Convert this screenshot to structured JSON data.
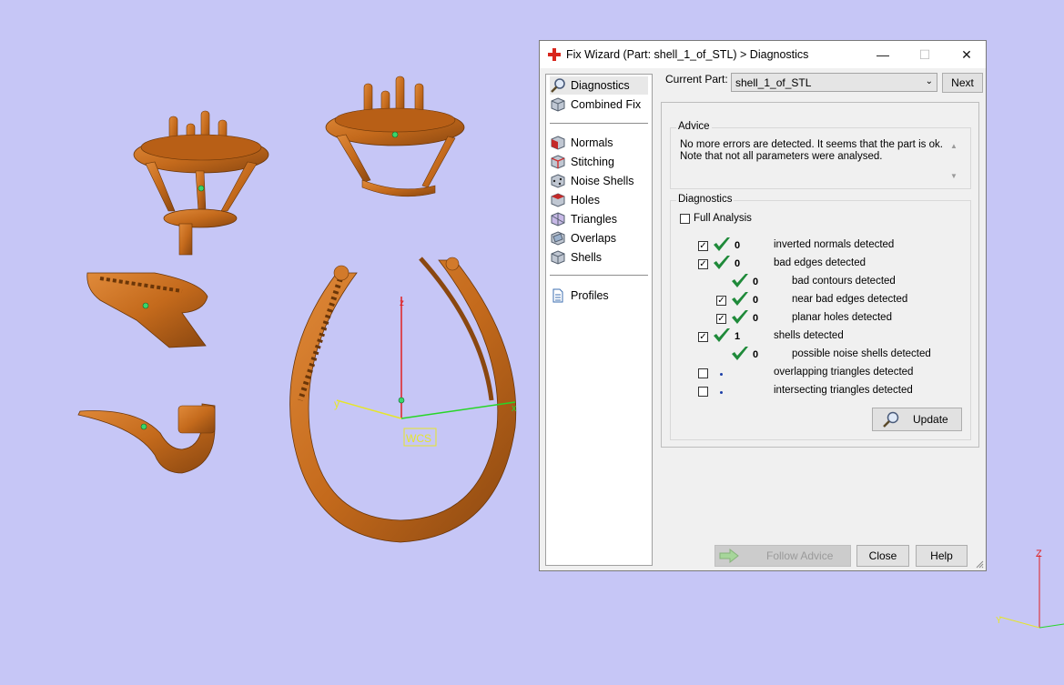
{
  "viewport": {
    "wcs_label": "WCS",
    "axis_z": "z",
    "axis_y": "y",
    "axis_x": "x",
    "corner_axis_z": "Z",
    "corner_axis_y": "Y",
    "model_color": "#c46a1c",
    "background": "#c6c6f6"
  },
  "dialog": {
    "title": "Fix Wizard (Part: shell_1_of_STL) > Diagnostics",
    "title_icon": "red-cross-icon",
    "nav": {
      "items_top": [
        {
          "label": "Diagnostics",
          "icon": "magnifier-icon",
          "selected": true
        },
        {
          "label": "Combined Fix",
          "icon": "cube-icon"
        }
      ],
      "items_mid": [
        {
          "label": "Normals",
          "icon": "normals-cube-icon"
        },
        {
          "label": "Stitching",
          "icon": "stitching-cube-icon"
        },
        {
          "label": "Noise Shells",
          "icon": "noise-shells-icon"
        },
        {
          "label": "Holes",
          "icon": "holes-cube-icon"
        },
        {
          "label": "Triangles",
          "icon": "triangles-cube-icon"
        },
        {
          "label": "Overlaps",
          "icon": "overlaps-cube-icon"
        },
        {
          "label": "Shells",
          "icon": "shells-cube-icon"
        }
      ],
      "items_bottom": [
        {
          "label": "Profiles",
          "icon": "document-icon"
        }
      ]
    },
    "current_part_label": "Current Part:",
    "current_part_value": "shell_1_of_STL",
    "next_label": "Next",
    "advice_title": "Advice",
    "advice_line1": "No more errors are detected. It seems that the part is ok.",
    "advice_line2": "Note that not all parameters were analysed.",
    "diagnostics_title": "Diagnostics",
    "full_analysis_label": "Full Analysis",
    "full_analysis_checked": false,
    "rows": [
      {
        "label": "inverted normals detected",
        "count": "0",
        "checked": true,
        "has_checkbox": true,
        "status": "ok",
        "indent": 0
      },
      {
        "label": "bad edges detected",
        "count": "0",
        "checked": true,
        "has_checkbox": true,
        "status": "ok",
        "indent": 0
      },
      {
        "label": "bad contours detected",
        "count": "0",
        "checked": false,
        "has_checkbox": false,
        "status": "ok",
        "indent": 1
      },
      {
        "label": "near bad edges detected",
        "count": "0",
        "checked": true,
        "has_checkbox": true,
        "status": "ok",
        "indent": 1
      },
      {
        "label": "planar holes detected",
        "count": "0",
        "checked": true,
        "has_checkbox": true,
        "status": "ok",
        "indent": 1
      },
      {
        "label": "shells detected",
        "count": "1",
        "checked": true,
        "has_checkbox": true,
        "status": "ok",
        "indent": 0
      },
      {
        "label": "possible noise shells detected",
        "count": "0",
        "checked": false,
        "has_checkbox": false,
        "status": "ok",
        "indent": 1
      },
      {
        "label": "overlapping triangles detected",
        "count": "",
        "checked": false,
        "has_checkbox": true,
        "status": "pending",
        "indent": 0
      },
      {
        "label": "intersecting triangles detected",
        "count": "",
        "checked": false,
        "has_checkbox": true,
        "status": "pending",
        "indent": 0
      }
    ],
    "update_label": "Update",
    "follow_advice_label": "Follow Advice",
    "close_label": "Close",
    "help_label": "Help"
  }
}
